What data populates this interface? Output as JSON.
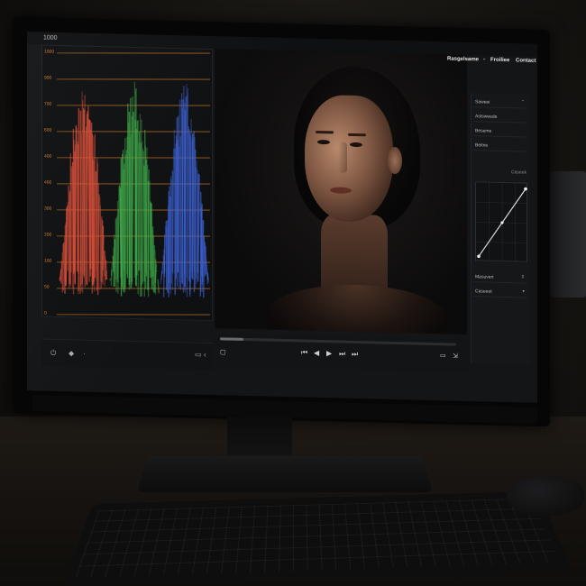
{
  "scope": {
    "top_label": "1000",
    "ticks": [
      "1000",
      "900",
      "700",
      "600",
      "400",
      "400",
      "300",
      "200",
      "100",
      "50",
      "0"
    ],
    "channel_colors": {
      "red": "#e0503a",
      "green": "#3fb04a",
      "blue": "#3d63d8"
    },
    "grid_color": "#d07a2a"
  },
  "tabs": {
    "first": "Rasgelsame",
    "separator": "•",
    "second": "Froiliee",
    "third": "Contact"
  },
  "side_panel": {
    "rows": [
      {
        "label": "Saweei",
        "chevron": "⌃"
      },
      {
        "label": "Astsweede",
        "chevron": ""
      },
      {
        "label": "Beseme",
        "chevron": ""
      },
      {
        "label": "Beitne",
        "chevron": ""
      }
    ],
    "curves_label": "Caseek",
    "bottom_rows": [
      {
        "label": "Masuvert",
        "chevron": "⇕"
      },
      {
        "label": "Caseeet",
        "chevron": "▾"
      }
    ]
  },
  "playback": {
    "progress": 0.1,
    "buttons": {
      "start": "⏮",
      "back": "◀",
      "play": "▶",
      "forward": "⏭",
      "end": "⏭"
    },
    "crop_icon": "crop-icon",
    "export_icon": "export-icon"
  },
  "scope_footer": {
    "power_icon": "⏻",
    "tag_icon": "◆",
    "dot": "·",
    "aspect_icon": "▭",
    "chevron": "‹"
  }
}
